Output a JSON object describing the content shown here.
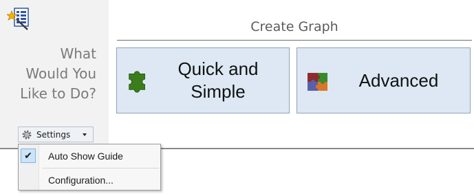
{
  "left_panel": {
    "prompt_lines": [
      "What",
      "Would You",
      "Like to Do?"
    ],
    "settings_label": "Settings",
    "icons": {
      "wizard": "graph-wizard-icon",
      "settings": "gear-icon",
      "caret": "chevron-down-icon"
    }
  },
  "create_graph": {
    "title": "Create Graph",
    "quick_simple": {
      "line1": "Quick and",
      "line2": "Simple",
      "icon": "puzzle-piece-icon"
    },
    "advanced": {
      "label": "Advanced",
      "icon": "puzzle-pieces-icon"
    }
  },
  "settings_menu": {
    "items": [
      {
        "label": "Auto Show Guide",
        "checked": true
      },
      {
        "label": "Configuration..."
      }
    ]
  },
  "colors": {
    "button_fill": "#dde8f4",
    "button_border": "#8fa2b6",
    "left_panel_bg": "#f2f2f2",
    "puzzle_green": "#3b7d1c"
  }
}
